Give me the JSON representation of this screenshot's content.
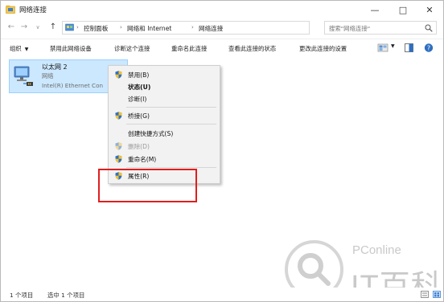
{
  "window": {
    "title": "网络连接"
  },
  "address": {
    "breadcrumbs": [
      "控制面板",
      "网络和 Internet",
      "网络连接"
    ]
  },
  "search": {
    "placeholder": "搜索\"网络连接\""
  },
  "toolbar": {
    "organize": "组织",
    "disable": "禁用此网络设备",
    "diagnose": "诊断这个连接",
    "rename": "重命名此连接",
    "status": "查看此连接的状态",
    "settings": "更改此连接的设置"
  },
  "connection": {
    "name": "以太网 2",
    "type": "网络",
    "device": "Intel(R) Ethernet Con"
  },
  "context_menu": {
    "items": [
      {
        "label": "禁用(B)",
        "icon": "shield-icon"
      },
      {
        "label": "状态(U)",
        "bold": true
      },
      {
        "label": "诊断(I)"
      },
      {
        "label": "桥接(G)",
        "icon": "shield-icon"
      },
      {
        "label": "创建快捷方式(S)"
      },
      {
        "label": "删除(D)",
        "icon": "shield-icon",
        "disabled": true
      },
      {
        "label": "重命名(M)",
        "icon": "shield-icon"
      },
      {
        "label": "属性(R)",
        "icon": "shield-icon"
      }
    ]
  },
  "watermark": {
    "brand": "PConline",
    "name": "IT百科"
  },
  "statusbar": {
    "count": "1 个项目",
    "selected": "选中 1 个项目"
  },
  "colors": {
    "selection": "#cce8ff",
    "highlight": "#e01e1e",
    "shield_blue": "#2f6fc0",
    "shield_yellow": "#f2c233"
  }
}
